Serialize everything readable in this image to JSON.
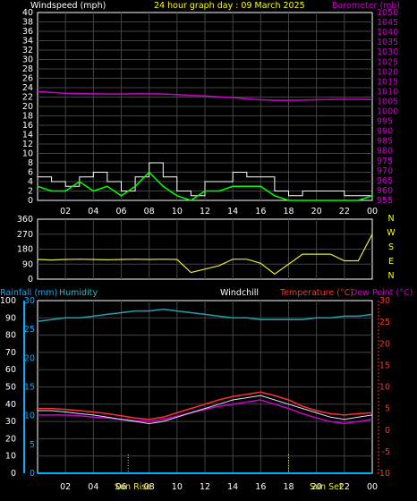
{
  "header": {
    "windspeed_label": "Windspeed (mph)",
    "title": "24 hour graph day : 09 March 2025",
    "barometer_label": "Barometer (mb)"
  },
  "colors": {
    "background": "#000000",
    "frame": "#ffffff",
    "grid": "#444444",
    "title": "#ffff00",
    "barometer": "#cc00cc",
    "gust": "#ffffff",
    "windspeed": "#00ff00",
    "direction": "#e8e838",
    "rainfall": "#00b0ff",
    "humidity": "#20a0b0",
    "temperature": "#ff3030",
    "dewpoint": "#cc00cc",
    "windchill": "#e0e0ff",
    "sun": "#e8e838"
  },
  "chart_data": [
    {
      "type": "line",
      "title": "24 hour graph day : 09 March 2025",
      "x_ticks": [
        "02",
        "04",
        "06",
        "08",
        "10",
        "12",
        "14",
        "16",
        "18",
        "20",
        "22",
        "00"
      ],
      "left_axis": {
        "label": "Windspeed (mph)",
        "range": [
          0,
          40
        ],
        "ticks": [
          "0",
          "2",
          "4",
          "6",
          "8",
          "10",
          "12",
          "14",
          "16",
          "18",
          "20",
          "22",
          "24",
          "26",
          "28",
          "30",
          "32",
          "34",
          "36",
          "38",
          "40"
        ]
      },
      "right_axis": {
        "label": "Barometer (mb)",
        "range": [
          955,
          1050
        ],
        "ticks": [
          "955",
          "960",
          "965",
          "970",
          "975",
          "980",
          "985",
          "990",
          "995",
          "1000",
          "1005",
          "1010",
          "1015",
          "1020",
          "1025",
          "1030",
          "1035",
          "1040",
          "1045",
          "1050"
        ]
      },
      "x": [
        0,
        1,
        2,
        3,
        4,
        5,
        6,
        7,
        8,
        9,
        10,
        11,
        12,
        13,
        14,
        15,
        16,
        17,
        18,
        19,
        20,
        21,
        22,
        23,
        24
      ],
      "series": [
        {
          "name": "Barometer (mb)",
          "axis": "right",
          "values": [
            1010,
            1009.6,
            1009.2,
            1009.0,
            1008.9,
            1008.8,
            1008.8,
            1008.9,
            1008.9,
            1008.8,
            1008.5,
            1008.1,
            1007.8,
            1007.4,
            1007.0,
            1006.4,
            1005.9,
            1005.6,
            1005.6,
            1005.7,
            1005.9,
            1006.0,
            1006.1,
            1006.1,
            1006.0
          ]
        },
        {
          "name": "Windspeed (mph)",
          "axis": "left",
          "values": [
            3,
            2,
            2,
            4,
            2,
            3,
            1,
            3,
            6,
            3,
            1,
            0,
            2,
            2,
            3,
            3,
            3,
            1,
            0,
            0,
            0,
            0,
            0,
            0,
            1
          ]
        },
        {
          "name": "Gust",
          "axis": "left",
          "values": [
            5,
            4,
            3,
            5,
            6,
            4,
            2,
            5,
            8,
            5,
            2,
            1,
            4,
            4,
            6,
            5,
            5,
            2,
            1,
            2,
            2,
            2,
            1,
            1,
            3
          ]
        }
      ]
    },
    {
      "type": "line",
      "right_labels": [
        "N",
        "W",
        "S",
        "E",
        "N"
      ],
      "axis": {
        "range": [
          0,
          360
        ],
        "ticks": [
          "0",
          "90",
          "180",
          "270",
          "360"
        ]
      },
      "x": [
        0,
        1,
        2,
        3,
        4,
        5,
        6,
        7,
        8,
        9,
        10,
        11,
        12,
        13,
        14,
        15,
        16,
        17,
        18,
        19,
        20,
        21,
        22,
        23,
        24
      ],
      "series": [
        {
          "name": "Wind direction",
          "values": [
            118,
            115,
            118,
            120,
            118,
            116,
            118,
            120,
            118,
            120,
            118,
            40,
            60,
            80,
            120,
            120,
            95,
            30,
            90,
            150,
            150,
            150,
            110,
            110,
            270
          ]
        }
      ]
    },
    {
      "type": "line",
      "legend": [
        "Rainfall (mm)",
        "Humidity",
        "Windchill",
        "Temperature (°C)",
        "Dew Point (°C)"
      ],
      "x_ticks": [
        "02",
        "04",
        "06",
        "08",
        "10",
        "12",
        "14",
        "16",
        "18",
        "20",
        "22",
        "00"
      ],
      "markers": [
        "Sun Rise",
        "Sun Set"
      ],
      "left_axis": {
        "label": "Rainfall (mm)",
        "range": [
          0,
          30
        ],
        "ticks": [
          "0",
          "5",
          "10",
          "15",
          "20",
          "25",
          "30"
        ]
      },
      "humidity_axis": {
        "label": "Humidity",
        "range": [
          0,
          100
        ],
        "ticks": [
          "0",
          "10",
          "20",
          "30",
          "40",
          "50",
          "60",
          "70",
          "80",
          "90",
          "100"
        ]
      },
      "right_axis": {
        "label": "Temperature (°C)",
        "range": [
          -10,
          30
        ],
        "ticks": [
          "-10",
          "-5",
          "0",
          "5",
          "10",
          "15",
          "20",
          "25",
          "30"
        ]
      },
      "x": [
        0,
        1,
        2,
        3,
        4,
        5,
        6,
        7,
        8,
        9,
        10,
        11,
        12,
        13,
        14,
        15,
        16,
        17,
        18,
        19,
        20,
        21,
        22,
        23,
        24
      ],
      "series": [
        {
          "name": "Rainfall (mm)",
          "axis": "left",
          "values": [
            0,
            0,
            0,
            0,
            0,
            0,
            0,
            0,
            0,
            0,
            0,
            0,
            0,
            0,
            0,
            0,
            0,
            0,
            0,
            0,
            0,
            0,
            0,
            0,
            0
          ]
        },
        {
          "name": "Humidity",
          "axis": "humidity",
          "values": [
            88,
            89,
            90,
            90,
            91,
            92,
            93,
            94,
            94,
            95,
            94,
            93,
            92,
            91,
            90,
            90,
            89,
            89,
            89,
            89,
            90,
            90,
            91,
            91,
            92
          ]
        },
        {
          "name": "Windchill",
          "axis": "right",
          "values": [
            4.5,
            4.5,
            4.2,
            3.8,
            3.5,
            3.0,
            2.5,
            2.0,
            1.5,
            2.0,
            3.0,
            4.0,
            5.0,
            6.0,
            7.0,
            7.5,
            8.0,
            7.0,
            6.0,
            5.0,
            4.0,
            3.0,
            2.5,
            3.0,
            3.5
          ]
        },
        {
          "name": "Temperature (°C)",
          "axis": "right",
          "values": [
            5.0,
            5.0,
            4.8,
            4.5,
            4.2,
            3.8,
            3.3,
            2.8,
            2.5,
            3.0,
            4.0,
            5.0,
            6.0,
            7.0,
            7.8,
            8.3,
            8.8,
            8.0,
            7.0,
            5.5,
            4.5,
            3.8,
            3.5,
            3.8,
            4.0
          ]
        },
        {
          "name": "Dew Point (°C)",
          "axis": "right",
          "values": [
            3.5,
            3.5,
            3.5,
            3.3,
            3.0,
            2.8,
            2.5,
            2.2,
            2.0,
            2.5,
            3.2,
            4.0,
            4.8,
            5.5,
            6.0,
            6.5,
            7.0,
            6.0,
            5.0,
            3.8,
            2.8,
            2.0,
            1.5,
            2.0,
            2.5
          ]
        }
      ],
      "sunrise_hour": 6.5,
      "sunset_hour": 18.0
    }
  ]
}
